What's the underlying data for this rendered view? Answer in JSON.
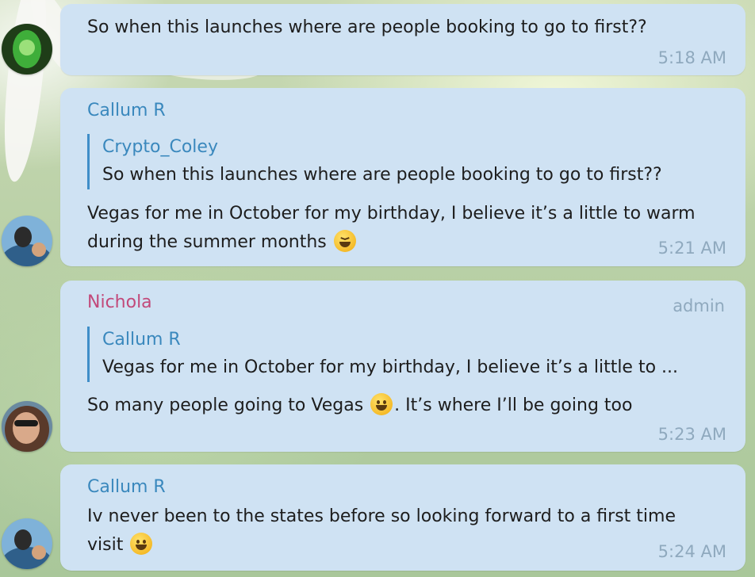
{
  "messages": [
    {
      "avatar_icon": "green-mask-avatar-icon",
      "text": "So when this launches where are people booking to go to first??",
      "time": "5:18 AM"
    },
    {
      "avatar_icon": "man-poolside-avatar-icon",
      "sender": "Callum R",
      "reply_to": {
        "name": "Crypto_Coley",
        "text": "So when this launches where are people booking to go to first??"
      },
      "text": "Vegas for me in October for my birthday, I believe it’s a little to warm during the summer months",
      "emoji": "laughing-face-emoji",
      "time": "5:21 AM"
    },
    {
      "avatar_icon": "woman-sunglasses-avatar-icon",
      "sender": "Nichola",
      "badge": "admin",
      "reply_to": {
        "name": "Callum R",
        "text": "Vegas for me in October for my birthday, I believe it’s a little to ..."
      },
      "text_before": "So many people going to Vegas",
      "emoji": "smiling-face-emoji",
      "text_after": ". It’s where I’ll be going too",
      "time": "5:23 AM"
    },
    {
      "avatar_icon": "man-poolside-avatar-icon",
      "sender": "Callum R",
      "text": "Iv never been to the states before so looking forward to a first time visit",
      "emoji": "smiling-face-emoji",
      "time": "5:24 AM"
    }
  ],
  "colors": {
    "bubble": "#cfe2f3",
    "sender_blue": "#3a88bd",
    "sender_pink": "#c2497a",
    "timestamp": "#8fa9be"
  }
}
